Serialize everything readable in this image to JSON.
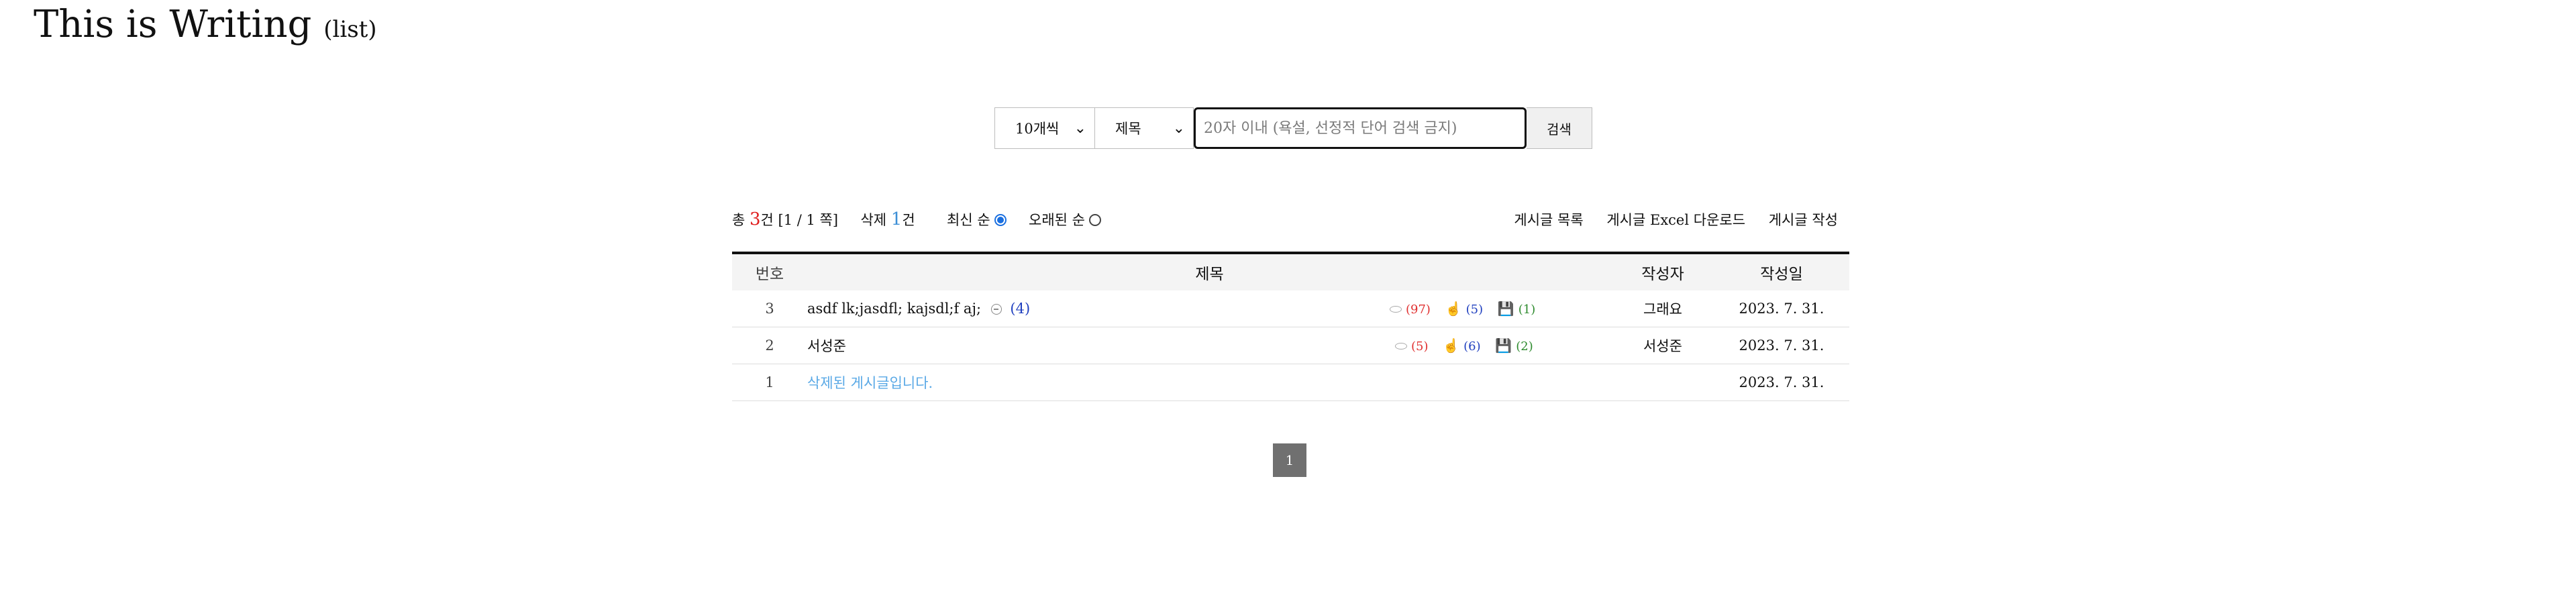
{
  "page": {
    "title": "This is Writing",
    "subtitle": "(list)"
  },
  "search": {
    "count_option": "10개씩",
    "field_option": "제목",
    "placeholder": "20자 이내 (욕설, 선정적 단어 검색 금지)",
    "button_label": "검색"
  },
  "summary": {
    "total_prefix": "총 ",
    "total_count": "3",
    "total_suffix": "건 [1 / 1 쪽]",
    "deleted_prefix": "삭제 ",
    "deleted_count": "1",
    "deleted_suffix": "건",
    "sort_newest": "최신 순",
    "sort_oldest": "오래된 순"
  },
  "actions": {
    "list": "게시글 목록",
    "excel": "게시글 Excel 다운로드",
    "write": "게시글 작성"
  },
  "table": {
    "headers": {
      "num": "번호",
      "title": "제목",
      "author": "작성자",
      "date": "작성일"
    },
    "rows": [
      {
        "num": "3",
        "title": "asdf lk;jasdfl; kajsdl;f aj;",
        "comments": "(4)",
        "views": "(97)",
        "likes": "(5)",
        "saves": "(1)",
        "author": "그래요",
        "date": "2023. 7. 31."
      },
      {
        "num": "2",
        "title": "서성준",
        "views": "(5)",
        "likes": "(6)",
        "saves": "(2)",
        "author": "서성준",
        "date": "2023. 7. 31."
      },
      {
        "num": "1",
        "title": "삭제된 게시글입니다.",
        "date": "2023. 7. 31."
      }
    ]
  },
  "pagination": {
    "current": "1"
  },
  "colors": {
    "accent_red": "#e02020",
    "accent_blue": "#3d8fd6",
    "page_button": "#707070"
  }
}
